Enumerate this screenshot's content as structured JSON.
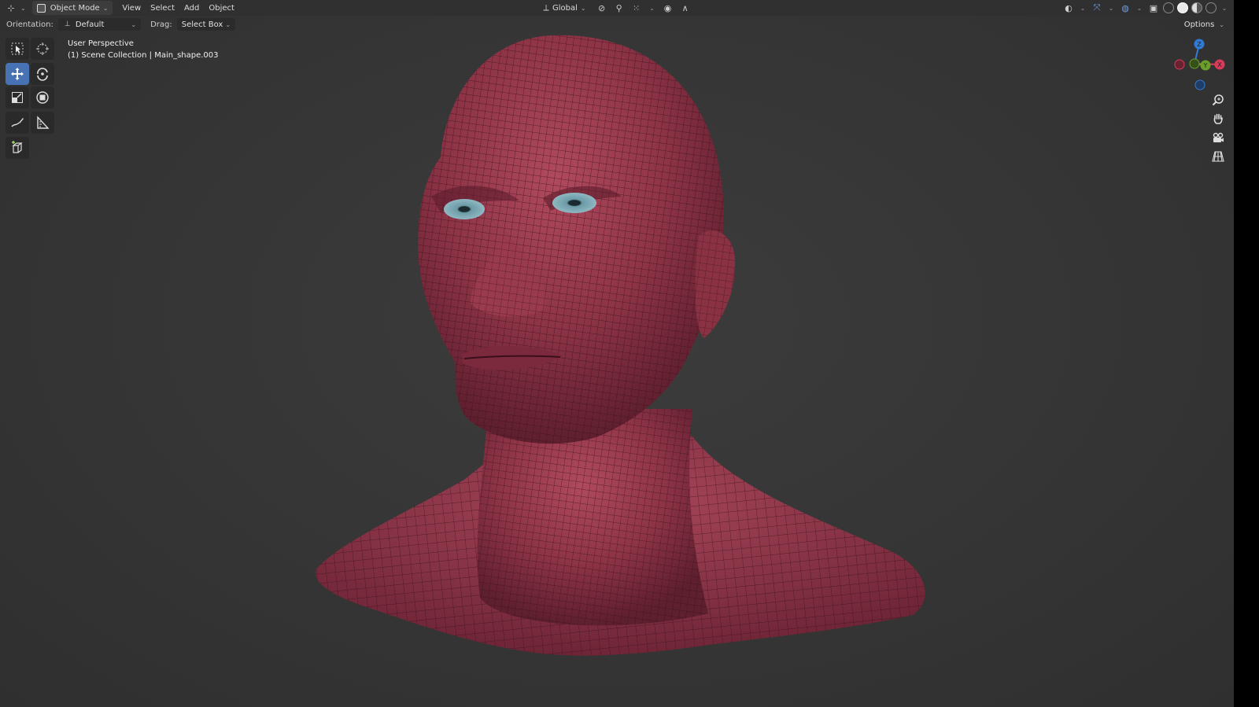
{
  "header": {
    "mode": "Object Mode",
    "menus": [
      "View",
      "Select",
      "Add",
      "Object"
    ],
    "transform_orientation": "Global"
  },
  "tool_settings": {
    "orientation_label": "Orientation:",
    "orientation_value": "Default",
    "drag_label": "Drag:",
    "drag_value": "Select Box",
    "options_label": "Options"
  },
  "viewport": {
    "view_name": "User Perspective",
    "collection_info": "(1) Scene Collection | Main_shape.003"
  },
  "gizmo": {
    "axes": [
      "X",
      "Y",
      "Z"
    ],
    "colors": {
      "x": "#d63c5a",
      "y": "#6a9f2a",
      "z": "#2f7bd6"
    }
  },
  "colors": {
    "accent": "#4772b3",
    "header_bg": "#303030",
    "mesh": "#8e3447"
  },
  "icons": {
    "left_tools": [
      "select-box-icon",
      "cursor-icon",
      "move-icon",
      "rotate-icon",
      "scale-icon",
      "transform-icon",
      "annotate-icon",
      "measure-icon",
      "add-cube-icon"
    ],
    "right_nav": [
      "zoom-icon",
      "pan-hand-icon",
      "camera-icon",
      "grid-view-icon"
    ]
  }
}
